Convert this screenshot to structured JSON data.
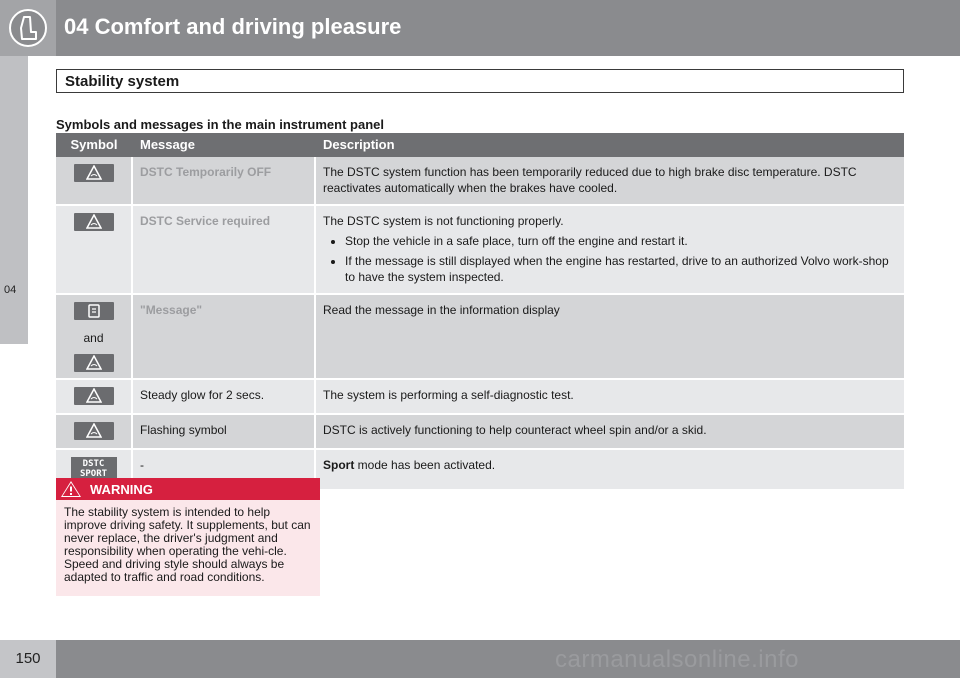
{
  "header": {
    "title": "04 Comfort and driving pleasure"
  },
  "side_tab": {
    "label": "04"
  },
  "section": {
    "title": "Stability system"
  },
  "table": {
    "heading": "Symbols and messages in the main instrument panel",
    "columns": {
      "symbol": "Symbol",
      "message": "Message",
      "description": "Description"
    },
    "rows": [
      {
        "message": "DSTC Temporarily OFF",
        "description": "The DSTC system function has been temporarily reduced due to high brake disc temperature. DSTC reactivates automatically when the brakes have cooled."
      },
      {
        "message": "DSTC Service required",
        "description": "The DSTC system is not functioning properly.",
        "bullets": [
          "Stop the vehicle in a safe place, turn off the engine and restart it.",
          "If the message is still displayed when the engine has restarted, drive to an authorized Volvo work-shop to have the system inspected."
        ]
      },
      {
        "message": "\"Message\"",
        "and_label": "and",
        "description": "Read the message in the information display"
      },
      {
        "message": "Steady glow for 2 secs.",
        "description": "The system is performing a self-diagnostic test."
      },
      {
        "message": "Flashing symbol",
        "description": "DSTC is actively functioning to help counteract wheel spin and/or a skid."
      },
      {
        "symbol_text_1": "DSTC",
        "symbol_text_2": "SPORT",
        "message": "-",
        "description_bold": "Sport",
        "description": " mode has been activated."
      }
    ]
  },
  "warning": {
    "title": "WARNING",
    "text": "The stability system is intended to help improve driving safety. It supplements, but can never replace, the driver's judgment and responsibility when operating the vehi-cle. Speed and driving style should always be adapted to traffic and road conditions."
  },
  "footer": {
    "page_number": "150",
    "watermark": "carmanualsonline.info"
  },
  "colors": {
    "header": "#8a8b8e",
    "warning": "#d6203f",
    "table_header": "#6e6f72"
  }
}
